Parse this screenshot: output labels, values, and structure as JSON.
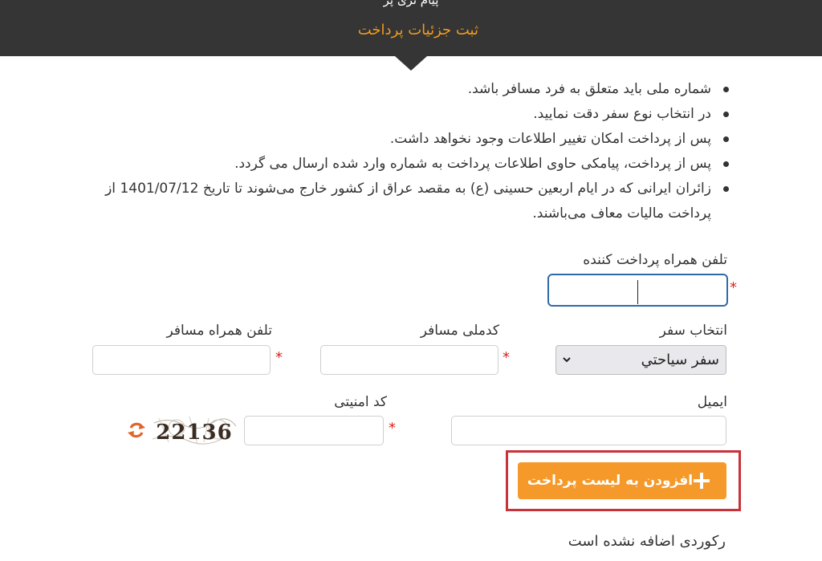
{
  "header": {
    "subtitle": "پیام تری پر",
    "title": "ثبت جزئیات پرداخت"
  },
  "notes": [
    "شماره ملی باید متعلق به فرد مسافر باشد.",
    "در انتخاب نوع سفر دقت نمایید.",
    "پس از پرداخت امکان تغییر اطلاعات وجود نخواهد داشت.",
    "پس از پرداخت، پیامکی حاوی اطلاعات پرداخت به شماره وارد شده ارسال می گردد.",
    "زائران ایرانی که در ایام اربعین حسینی (ع) به مقصد عراق از کشور خارج می‌شوند تا تاریخ 1401/07/12 از پرداخت مالیات معاف می‌باشند."
  ],
  "form": {
    "payer_phone_label": "تلفن همراه پرداخت کننده",
    "trip_select_label": "انتخاب سفر",
    "trip_select_value": "سفر سیاحتي",
    "national_code_label": "کدملی مسافر",
    "passenger_phone_label": "تلفن همراه مسافر",
    "email_label": "ایمیل",
    "security_code_label": "کد امنیتی",
    "captcha_text": "22136",
    "required_mark": "*"
  },
  "actions": {
    "add_button_label": "افزودن به لیست پرداخت"
  },
  "list": {
    "empty_message": "رکوردی اضافه نشده است"
  },
  "colors": {
    "header_bg": "#353535",
    "accent": "#f29b1d",
    "button": "#f5992a",
    "required": "#d9251c",
    "highlight": "#c8323a",
    "focus": "#2f6aa8"
  }
}
